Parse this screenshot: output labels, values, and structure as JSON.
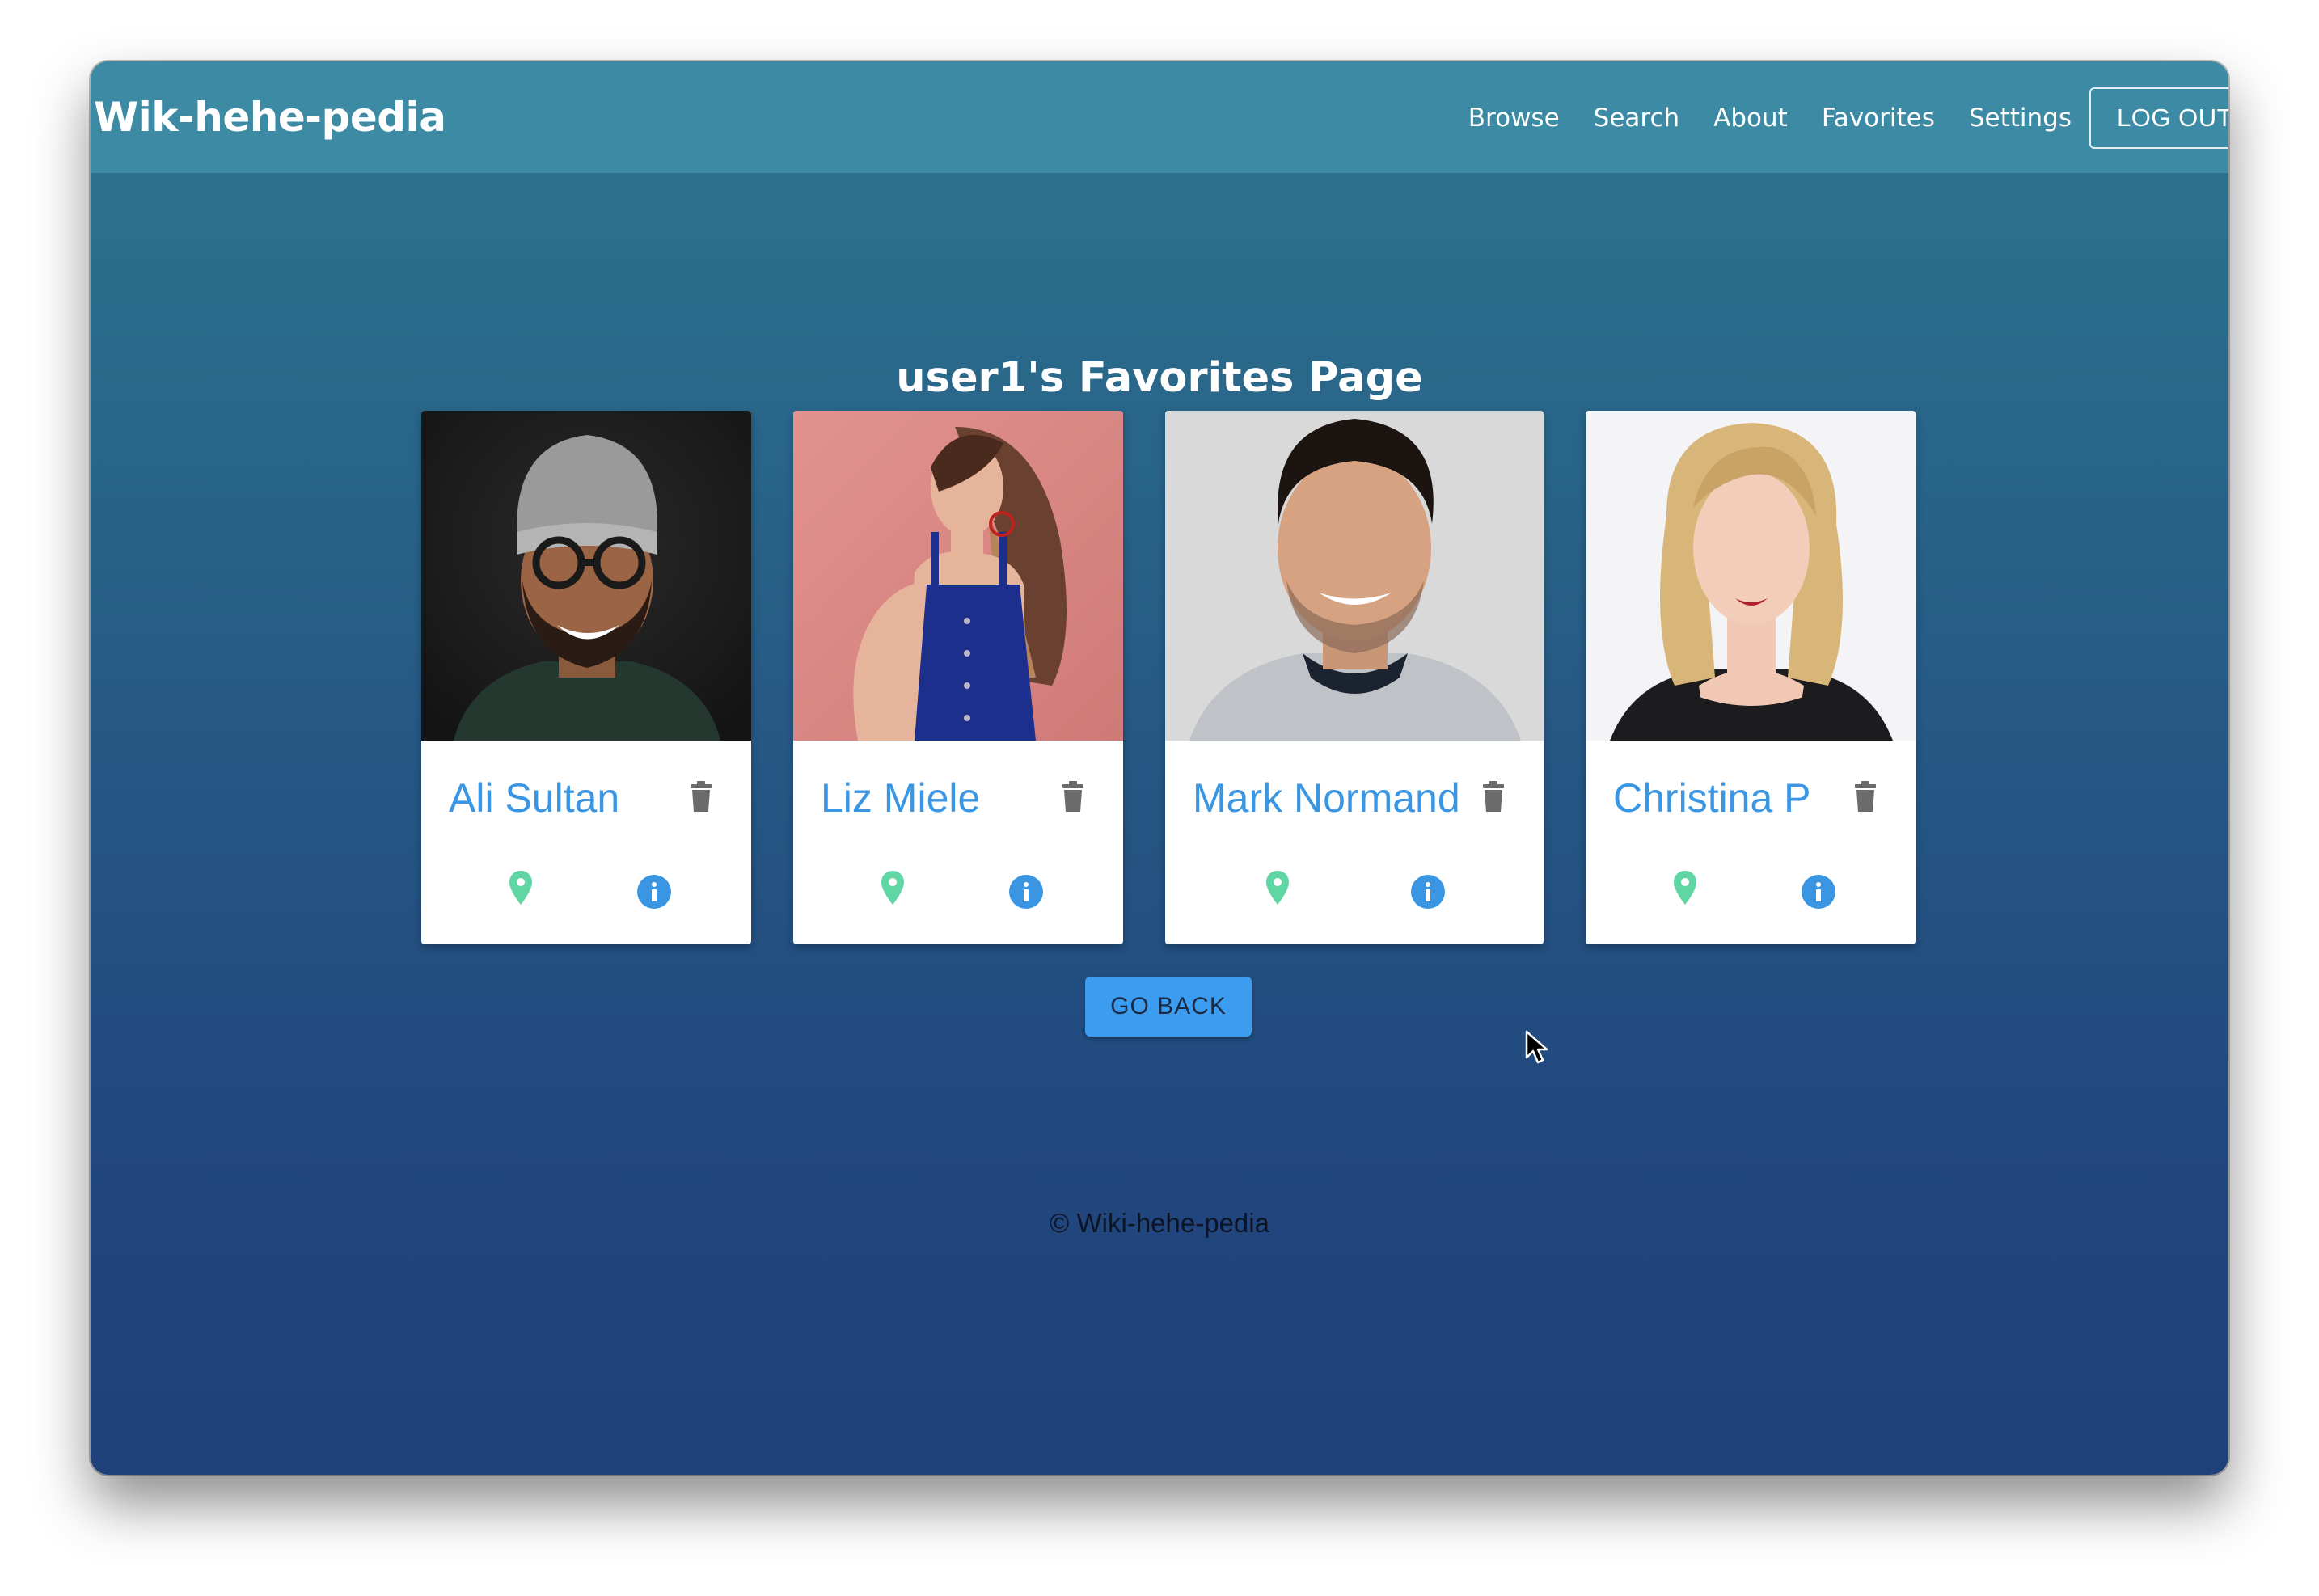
{
  "app": {
    "brand": "Wik-hehe-pedia"
  },
  "nav": {
    "links": [
      "Browse",
      "Search",
      "About",
      "Favorites",
      "Settings"
    ],
    "logout_label": "LOG OUT"
  },
  "main": {
    "title": "user1's Favorites Page",
    "cards": [
      {
        "name": "Ali Sultan"
      },
      {
        "name": "Liz Miele"
      },
      {
        "name": "Mark Normand"
      },
      {
        "name": "Christina P"
      }
    ],
    "go_back_label": "GO BACK"
  },
  "footer": {
    "text": "© Wiki-hehe-pedia"
  },
  "icons": {
    "trash": "trash-icon",
    "location": "map-pin-icon",
    "info": "info-icon"
  },
  "colors": {
    "navbar": "#3c8aa3",
    "background_top": "#2d7590",
    "background_bottom": "#1f417a",
    "card_name": "#3a96e3",
    "pin": "#5fd6a4",
    "info": "#3a96e3",
    "button": "#3c9df0"
  }
}
